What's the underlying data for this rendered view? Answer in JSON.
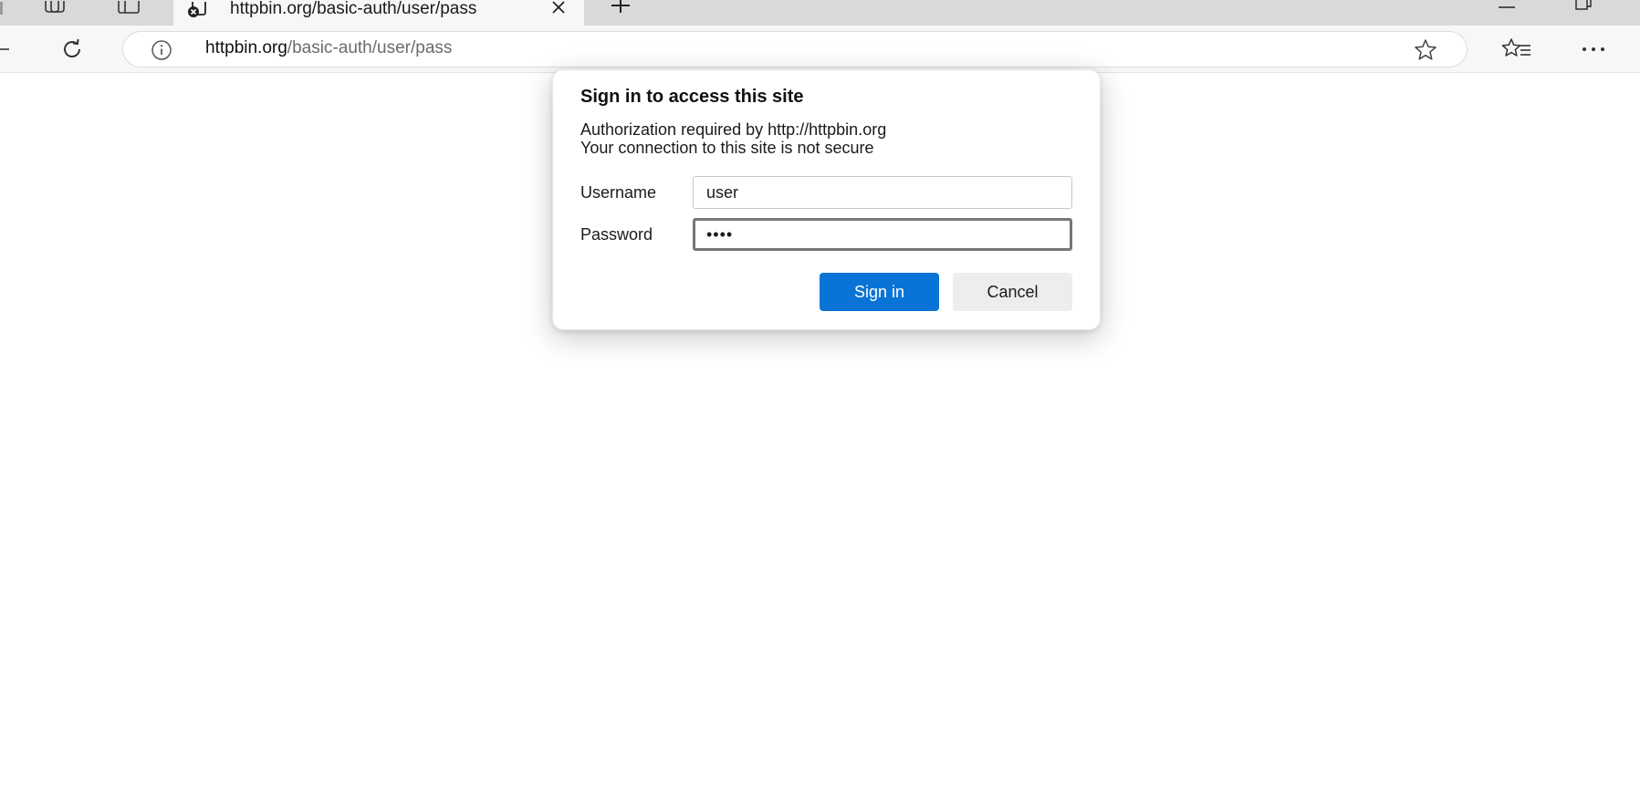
{
  "tab": {
    "title": "httpbin.org/basic-auth/user/pass"
  },
  "address_bar": {
    "host": "httpbin.org",
    "path": "/basic-auth/user/pass"
  },
  "icons": {
    "workspaces": "workspaces-icon",
    "tab_actions": "vertical-tabs-icon",
    "favicon": "page-favicon-icon",
    "close_tab": "close-icon",
    "new_tab": "plus-icon",
    "minimize": "minimize-icon",
    "restore": "restore-icon",
    "back": "back-arrow-icon",
    "refresh": "refresh-icon",
    "site_info": "info-icon",
    "add_favorite": "star-icon",
    "favorites": "favorites-icon",
    "more": "more-icon"
  },
  "dialog": {
    "title": "Sign in to access this site",
    "message_line1": "Authorization required by http://httpbin.org",
    "message_line2": "Your connection to this site is not secure",
    "username_label": "Username",
    "username_value": "user",
    "password_label": "Password",
    "password_value": "pass",
    "signin_label": "Sign in",
    "cancel_label": "Cancel"
  },
  "colors": {
    "primary_button": "#0a74d6",
    "tabstrip": "#d9d9d9",
    "toolbar": "#f7f7f7"
  }
}
